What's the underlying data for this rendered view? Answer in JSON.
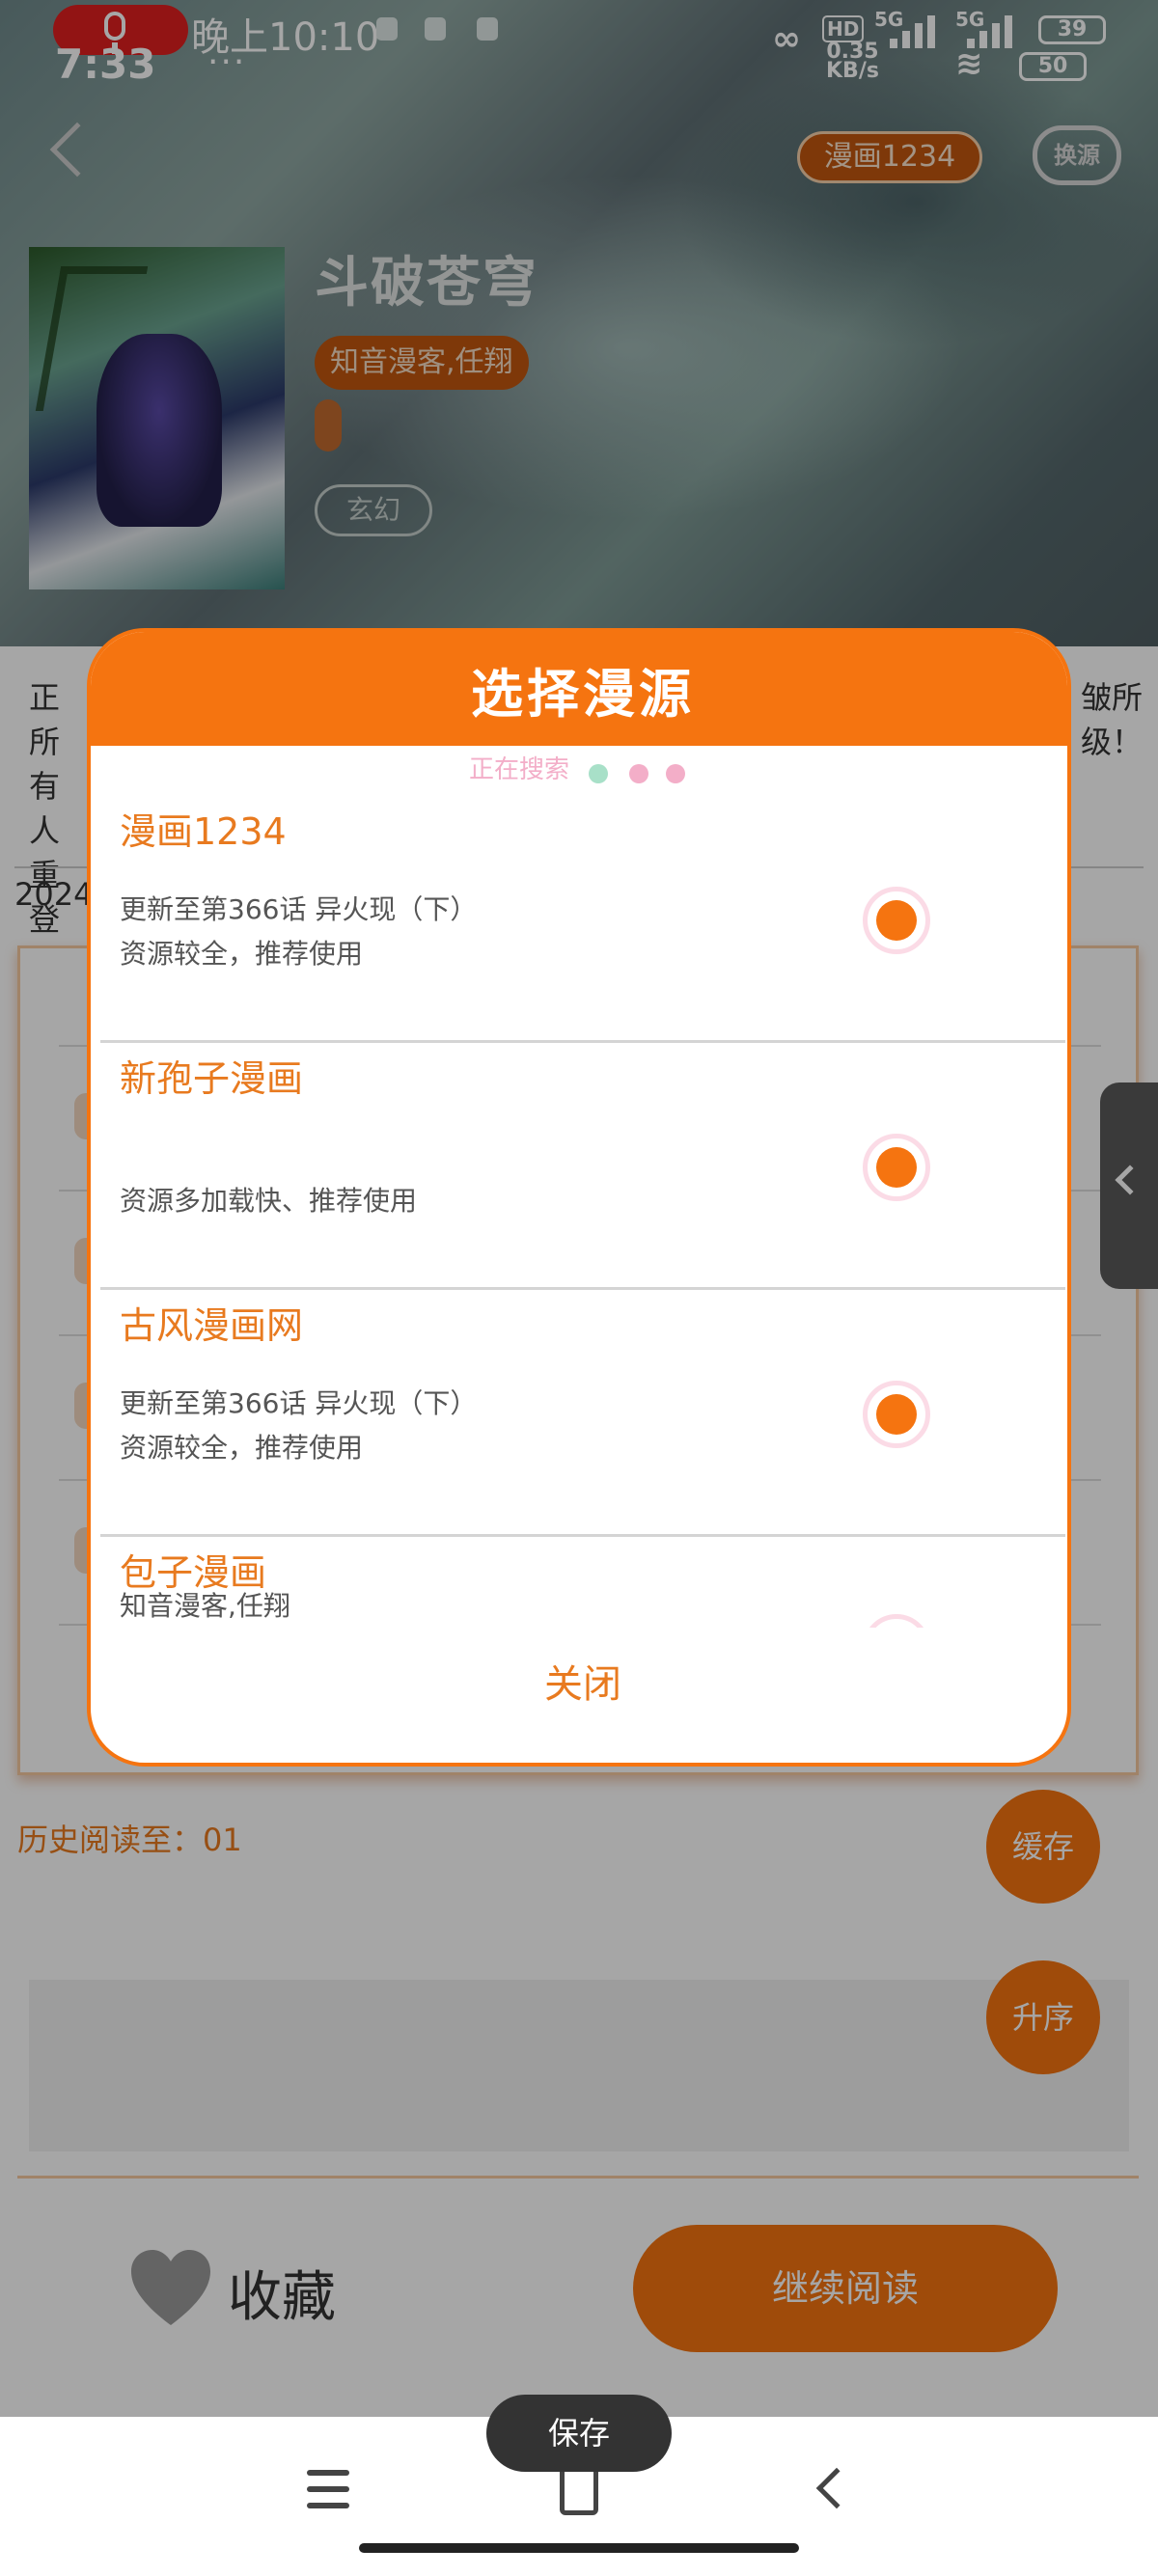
{
  "status_bar": {
    "clock": "7:33",
    "time_text": "晚上10:10",
    "more": "···",
    "net_speed_value": "0.35",
    "net_speed_unit": "KB/s",
    "hd_label": "HD",
    "network_5g_1": "5G",
    "network_5g_2": "5G",
    "battery_1": "39",
    "battery_2": "50"
  },
  "header": {
    "source_badge": "漫画1234",
    "switch_source": "换源"
  },
  "comic": {
    "title": "斗破苍穹",
    "authors": "知音漫客,任翔",
    "genre": "玄幻",
    "description_left": "正所\n有人\n重登",
    "description_right": "皱所\n级！",
    "date_fragment": "2024"
  },
  "history": "历史阅读至：01",
  "buttons": {
    "cache": "缓存",
    "sort": "升序",
    "favorite": "收藏",
    "continue_reading": "继续阅读"
  },
  "toast": "保存",
  "dialog": {
    "title": "选择漫源",
    "searching": "正在搜索",
    "close": "关闭",
    "sources": [
      {
        "name": "漫画1234",
        "update": "更新至第366话 异火现（下）",
        "note": "资源较全，推荐使用"
      },
      {
        "name": "新孢子漫画",
        "update": "",
        "note": "资源多加载快、推荐使用"
      },
      {
        "name": "古风漫画网",
        "update": "更新至第366话 异火现（下）",
        "note": "资源较全，推荐使用"
      },
      {
        "name": "包子漫画",
        "update": "知音漫客,任翔",
        "note": ""
      }
    ]
  },
  "colors": {
    "accent": "#f57410",
    "accent_text": "#e87a1f",
    "radio_ring": "#fbdbe6",
    "search_dot_1": "#a8e0c8",
    "search_dot_2": "#f3aec8",
    "search_dot_3": "#f3aec8"
  }
}
